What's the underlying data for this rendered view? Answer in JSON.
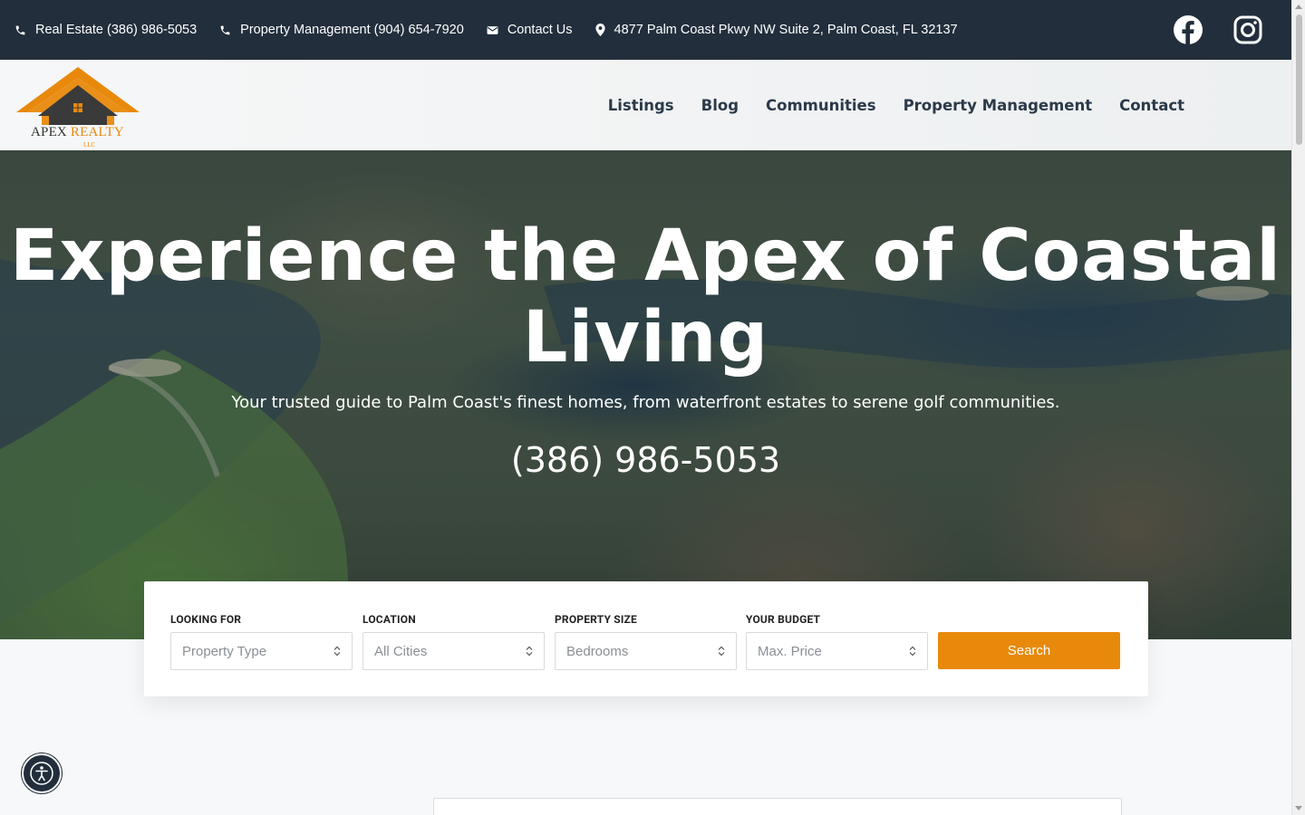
{
  "topbar": {
    "real_estate": "Real Estate (386) 986-5053",
    "property_management": "Property Management (904) 654-7920",
    "contact": "Contact Us",
    "address": "4877 Palm Coast Pkwy NW Suite 2, Palm Coast, FL 32137",
    "social": [
      "facebook-icon",
      "instagram-icon"
    ]
  },
  "brand": {
    "name_part1": "APEX ",
    "name_part2": "REALTY",
    "suffix": "LLC",
    "accent_color": "#e8890c",
    "dark_color": "#222e3c"
  },
  "nav": {
    "items": [
      "Listings",
      "Blog",
      "Communities",
      "Property Management",
      "Contact"
    ]
  },
  "hero": {
    "title": "Experience the Apex of Coastal Living",
    "subtitle": "Your trusted guide to Palm Coast's finest homes, from waterfront estates to serene golf communities.",
    "phone": "(386) 986-5053"
  },
  "search": {
    "fields": [
      {
        "label": "LOOKING FOR",
        "value": "Property Type"
      },
      {
        "label": "LOCATION",
        "value": "All Cities"
      },
      {
        "label": "PROPERTY SIZE",
        "value": "Bedrooms"
      },
      {
        "label": "YOUR BUDGET",
        "value": "Max. Price"
      }
    ],
    "button": "Search"
  }
}
